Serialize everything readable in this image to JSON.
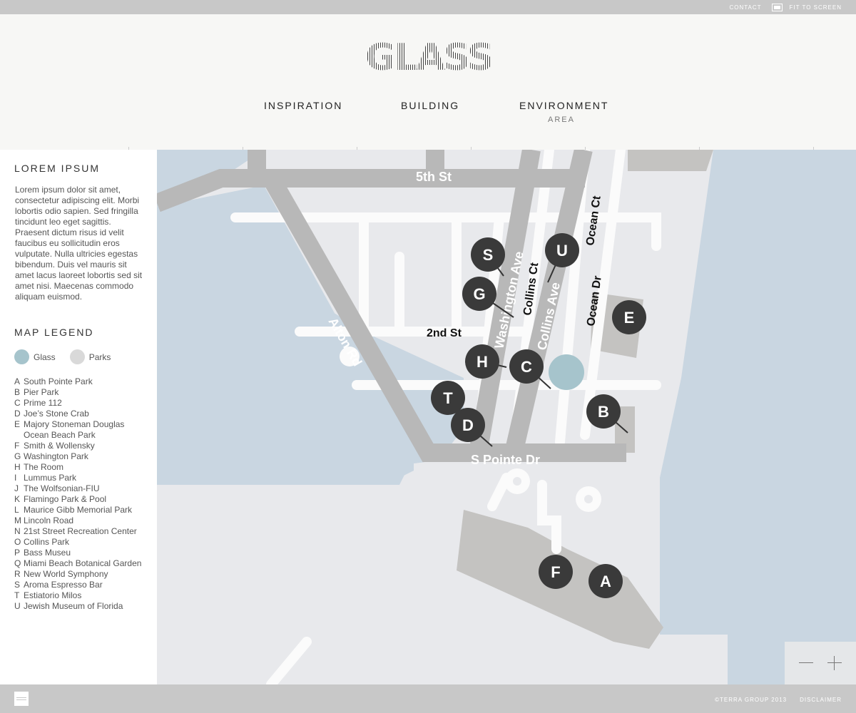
{
  "topbar": {
    "contact": "CONTACT",
    "fit_to_screen": "FIT TO SCREEN"
  },
  "header": {
    "logo": "GLASS",
    "nav": [
      {
        "label": "INSPIRATION"
      },
      {
        "label": "BUILDING"
      },
      {
        "label": "ENVIRONMENT",
        "sub": "AREA"
      }
    ]
  },
  "sidebar": {
    "title": "LOREM IPSUM",
    "text": "Lorem ipsum dolor sit amet, consectetur adipiscing elit. Morbi lobortis odio sapien. Sed fringilla tincidunt leo eget sagittis. Praesent dictum risus id velit faucibus eu sollicitudin eros vulputate. Nulla ultricies egestas bibendum. Duis vel mauris sit amet lacus laoreet lobortis sed sit amet nisi. Maecenas commodo aliquam euismod.",
    "legend_title": "MAP LEGEND",
    "keys": [
      {
        "label": "Glass",
        "color": "#a6c4cc"
      },
      {
        "label": "Parks",
        "color": "#d9d9d9"
      }
    ],
    "places": [
      {
        "letter": "A",
        "name": "South Pointe Park"
      },
      {
        "letter": "B",
        "name": "Pier Park"
      },
      {
        "letter": "C",
        "name": "Prime 112"
      },
      {
        "letter": "D",
        "name": "Joe’s Stone Crab"
      },
      {
        "letter": "E",
        "name": "Majory Stoneman Douglas Ocean Beach Park"
      },
      {
        "letter": "F",
        "name": "Smith & Wollensky"
      },
      {
        "letter": "G",
        "name": "Washington Park"
      },
      {
        "letter": "H",
        "name": "The Room"
      },
      {
        "letter": "I",
        "name": "Lummus Park"
      },
      {
        "letter": "J",
        "name": "The Wolfsonian-FIU"
      },
      {
        "letter": "K",
        "name": "Flamingo Park & Pool"
      },
      {
        "letter": "L",
        "name": "Maurice Gibb Memorial Park"
      },
      {
        "letter": "M",
        "name": "Lincoln Road"
      },
      {
        "letter": "N",
        "name": "21st  Street Recreation Center"
      },
      {
        "letter": "O",
        "name": "Collins Park"
      },
      {
        "letter": "P",
        "name": "Bass Museu"
      },
      {
        "letter": "Q",
        "name": "Miami Beach Botanical Garden"
      },
      {
        "letter": "R",
        "name": "New World Symphony"
      },
      {
        "letter": "S",
        "name": "Aroma Espresso Bar"
      },
      {
        "letter": "T",
        "name": "Estiatorio Milos"
      },
      {
        "letter": "U",
        "name": "Jewish Museum of Florida"
      }
    ]
  },
  "map": {
    "streets": {
      "fifth": "5th St",
      "second": "2nd St",
      "alton": "Alton Rd",
      "washington": "Washington Ave",
      "collins_ct": "Collins Ct",
      "collins_ave": "Collins Ave",
      "ocean_ct": "Ocean Ct",
      "ocean_dr": "Ocean Dr",
      "s_pointe": "S Pointe Dr"
    },
    "markers": [
      "S",
      "U",
      "G",
      "E",
      "H",
      "C",
      "T",
      "D",
      "B",
      "F",
      "A"
    ],
    "colors": {
      "water": "#c9d6e1",
      "land": "#e8e9ec",
      "parks": "#c4c3c1",
      "roads": "#b7b7b7",
      "glass": "#a6c4cc",
      "marker": "#3a3a3a"
    }
  },
  "footer": {
    "copyright": "©TERRA GROUP 2013",
    "disclaimer": "DISCLAIMER"
  }
}
